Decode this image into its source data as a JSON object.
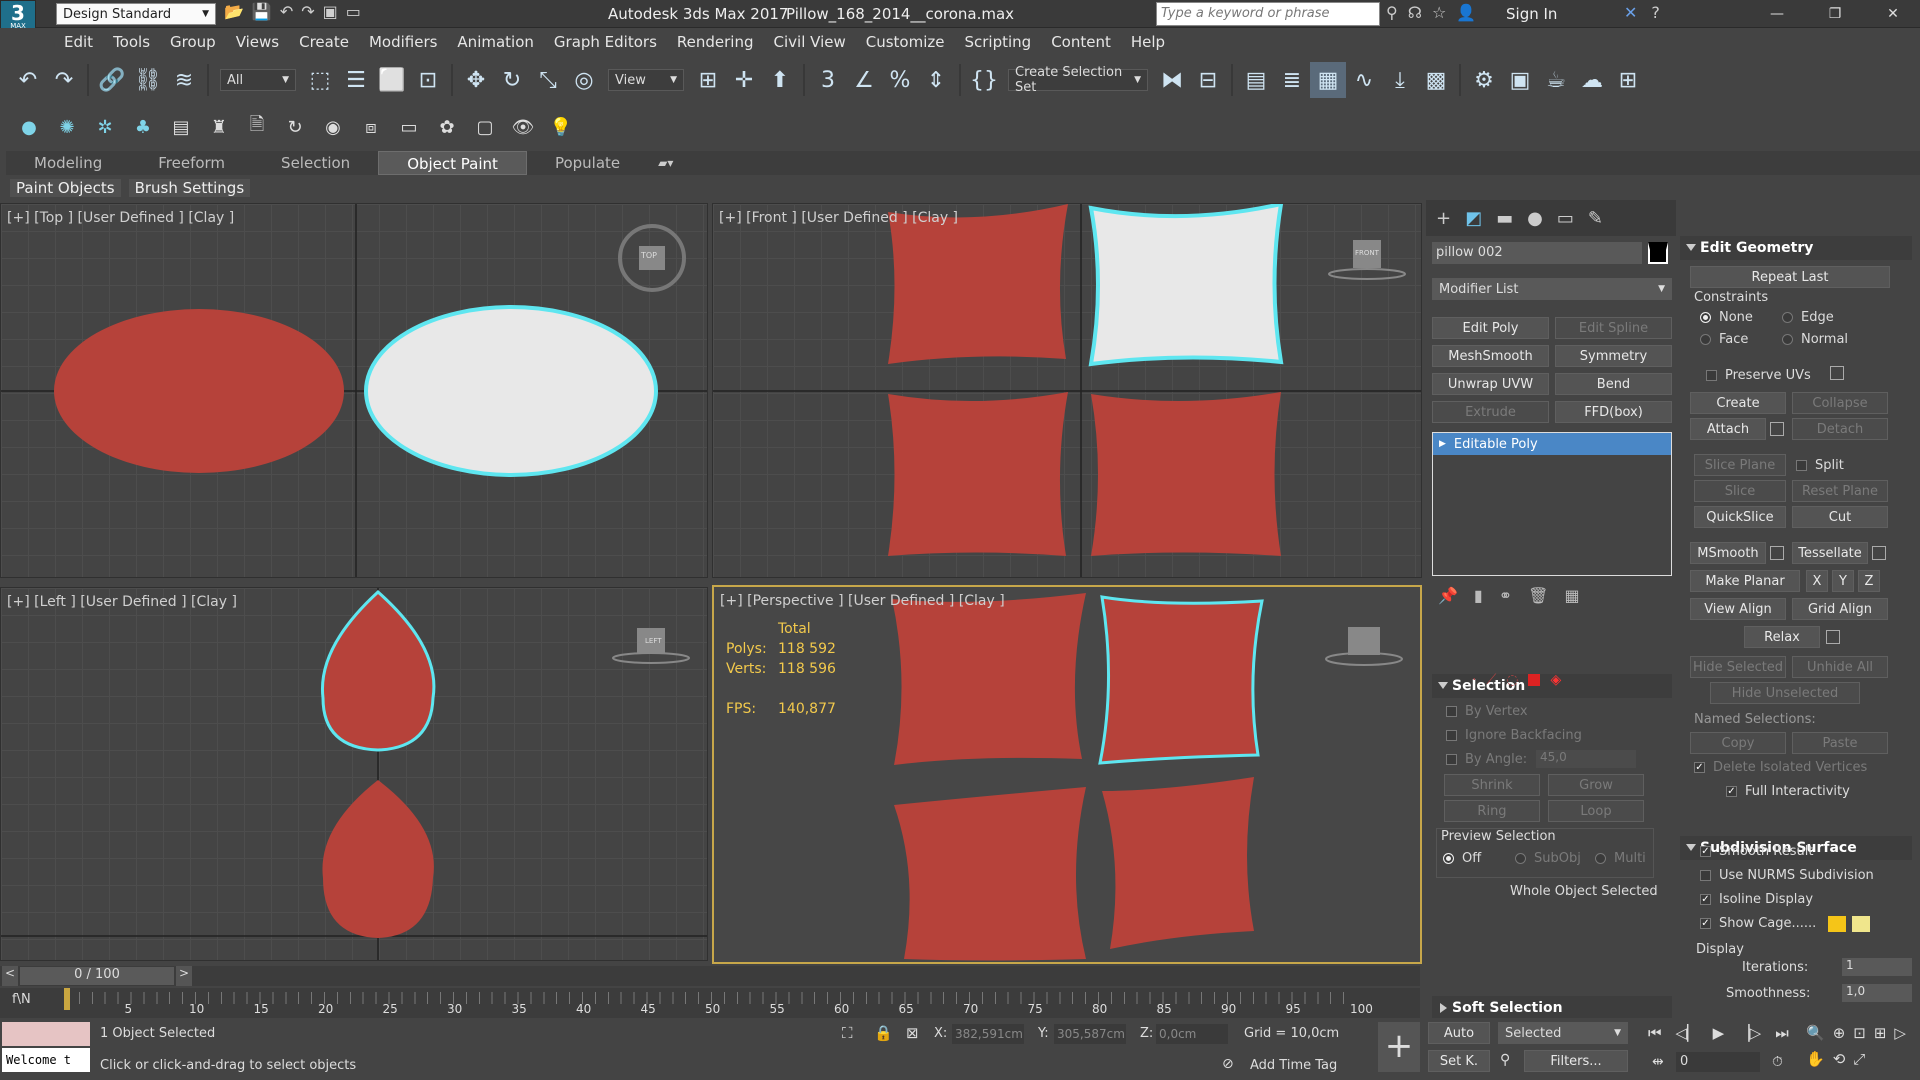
{
  "app": {
    "logo_line1": "3",
    "logo_line2": "MAX",
    "workspace": "Design Standard",
    "app_title": "Autodesk 3ds Max 2017",
    "file_name": "Pillow_168_2014__corona.max",
    "search_placeholder": "Type a keyword or phrase",
    "sign_in": "Sign In"
  },
  "menu": [
    "Edit",
    "Tools",
    "Group",
    "Views",
    "Create",
    "Modifiers",
    "Animation",
    "Graph Editors",
    "Rendering",
    "Civil View",
    "Customize",
    "Scripting",
    "Content",
    "Help"
  ],
  "toolbar": {
    "selection_filter": "All",
    "ref_coord": "View",
    "selection_set": "Create Selection Set"
  },
  "ribbon": {
    "tabs": [
      "Modeling",
      "Freeform",
      "Selection",
      "Object Paint",
      "Populate"
    ],
    "active_tab": "Object Paint",
    "subtabs": [
      "Paint Objects",
      "Brush Settings"
    ]
  },
  "viewports": {
    "top": {
      "label": "[+] [Top ] [User Defined ] [Clay ]",
      "cube": "TOP"
    },
    "front": {
      "label": "[+] [Front ] [User Defined ] [Clay ]",
      "cube": "FRONT"
    },
    "left": {
      "label": "[+] [Left ] [User Defined ] [Clay ]",
      "cube": "LEFT"
    },
    "persp": {
      "label": "[+] [Perspective ] [User Defined ] [Clay ]",
      "stats_header": "Total",
      "polys_label": "Polys:",
      "polys": "118 592",
      "verts_label": "Verts:",
      "verts": "118 596",
      "fps_label": "FPS:",
      "fps": "140,877"
    }
  },
  "command_panel": {
    "object_name": "pillow 002",
    "modifier_list": "Modifier List",
    "modifier_buttons": [
      "Edit Poly",
      "Edit Spline",
      "MeshSmooth",
      "Symmetry",
      "Unwrap UVW",
      "Bend",
      "Extrude",
      "FFD(box)"
    ],
    "stack_item": "Editable Poly",
    "selection": {
      "title": "Selection",
      "by_vertex": "By Vertex",
      "ignore_backfacing": "Ignore Backfacing",
      "by_angle": "By Angle:",
      "angle_value": "45,0",
      "shrink": "Shrink",
      "grow": "Grow",
      "ring": "Ring",
      "loop": "Loop",
      "preview_selection": "Preview Selection",
      "off": "Off",
      "subobj": "SubObj",
      "multi": "Multi",
      "whole_object": "Whole Object Selected"
    },
    "soft_selection": "Soft Selection",
    "edit_geometry": {
      "title": "Edit Geometry",
      "repeat_last": "Repeat Last",
      "constraints": "Constraints",
      "none": "None",
      "edge": "Edge",
      "face": "Face",
      "normal": "Normal",
      "preserve_uvs": "Preserve UVs",
      "create": "Create",
      "collapse": "Collapse",
      "attach": "Attach",
      "detach": "Detach",
      "slice_plane": "Slice Plane",
      "split": "Split",
      "slice": "Slice",
      "reset_plane": "Reset Plane",
      "quickslice": "QuickSlice",
      "cut": "Cut",
      "msmooth": "MSmooth",
      "tessellate": "Tessellate",
      "make_planar": "Make Planar",
      "x": "X",
      "y": "Y",
      "z": "Z",
      "view_align": "View Align",
      "grid_align": "Grid Align",
      "relax": "Relax",
      "hide_selected": "Hide Selected",
      "unhide_all": "Unhide All",
      "hide_unselected": "Hide Unselected",
      "named_selections": "Named Selections:",
      "copy": "Copy",
      "paste": "Paste",
      "delete_isolated": "Delete Isolated Vertices",
      "full_interactivity": "Full Interactivity"
    },
    "subdivision": {
      "title": "Subdivision Surface",
      "smooth_result": "Smooth Result",
      "use_nurms": "Use NURMS Subdivision",
      "isoline": "Isoline Display",
      "show_cage": "Show Cage......",
      "display": "Display",
      "iterations_label": "Iterations:",
      "iterations": "1",
      "smoothness_label": "Smoothness:",
      "smoothness": "1,0",
      "cage_color1": "#f5c518",
      "cage_color2": "#f0e68c"
    }
  },
  "timeline": {
    "frame": "0 / 100",
    "ticks": [
      "5",
      "10",
      "15",
      "20",
      "25",
      "30",
      "35",
      "40",
      "45",
      "50",
      "55",
      "60",
      "65",
      "70",
      "75",
      "80",
      "85",
      "90",
      "95",
      "100"
    ]
  },
  "status": {
    "selected": "1 Object Selected",
    "prompt": "Click or click-and-drag to select objects",
    "welcome": "Welcome t",
    "x_label": "X:",
    "x": "382,591cm",
    "y_label": "Y:",
    "y": "305,587cm",
    "z_label": "Z:",
    "z": "0,0cm",
    "grid": "Grid = 10,0cm",
    "add_time_tag": "Add Time Tag",
    "auto": "Auto",
    "set_key": "Set K.",
    "key_mode": "Selected",
    "filters": "Filters...",
    "frame_field": "0"
  },
  "colors": {
    "pillow": "#b6423a",
    "selection": "#5ee6f0",
    "bg": "#444444"
  }
}
